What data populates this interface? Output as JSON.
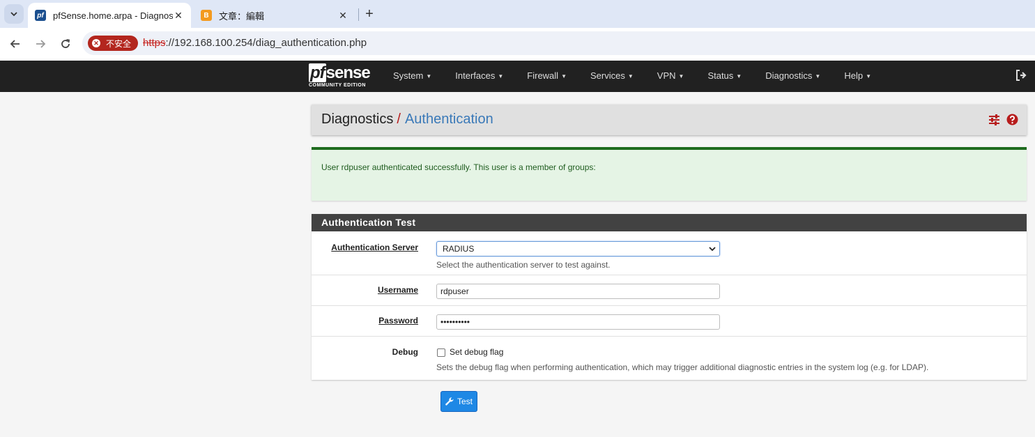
{
  "browser": {
    "tabs": [
      {
        "title": "pfSense.home.arpa - Diagnos",
        "favicon": "pf",
        "active": true
      },
      {
        "title": "文章：編輯",
        "favicon": "B",
        "active": false
      }
    ],
    "close_glyph": "✕",
    "new_tab_glyph": "+",
    "security_chip": "不安全",
    "url_scheme": "https",
    "url_rest": "://192.168.100.254/diag_authentication.php"
  },
  "navbar": {
    "logo_pf": "pf",
    "logo_sense": "sense",
    "logo_sub": "COMMUNITY EDITION",
    "menu": [
      {
        "label": "System"
      },
      {
        "label": "Interfaces"
      },
      {
        "label": "Firewall"
      },
      {
        "label": "Services"
      },
      {
        "label": "VPN"
      },
      {
        "label": "Status"
      },
      {
        "label": "Diagnostics"
      },
      {
        "label": "Help"
      }
    ]
  },
  "breadcrumb": {
    "parent": "Diagnostics",
    "separator": "/",
    "current": "Authentication"
  },
  "alert": {
    "message": "User rdpuser authenticated successfully. This user is a member of groups:"
  },
  "panel": {
    "title": "Authentication Test",
    "server": {
      "label": "Authentication Server",
      "value": "RADIUS",
      "help": "Select the authentication server to test against."
    },
    "username": {
      "label": "Username",
      "value": "rdpuser"
    },
    "password": {
      "label": "Password",
      "value": "••••••••••"
    },
    "debug": {
      "label": "Debug",
      "checkbox_label": "Set debug flag",
      "checked": false,
      "help": "Sets the debug flag when performing authentication, which may trigger additional diagnostic entries in the system log (e.g. for LDAP)."
    }
  },
  "actions": {
    "test_label": "Test"
  },
  "colors": {
    "navbar": "#212121",
    "breadcrumb_current": "#3a79b8",
    "breadcrumb_separator": "#b71c1c",
    "alert_border": "#1e6b1e",
    "primary_button": "#1e88e5"
  }
}
